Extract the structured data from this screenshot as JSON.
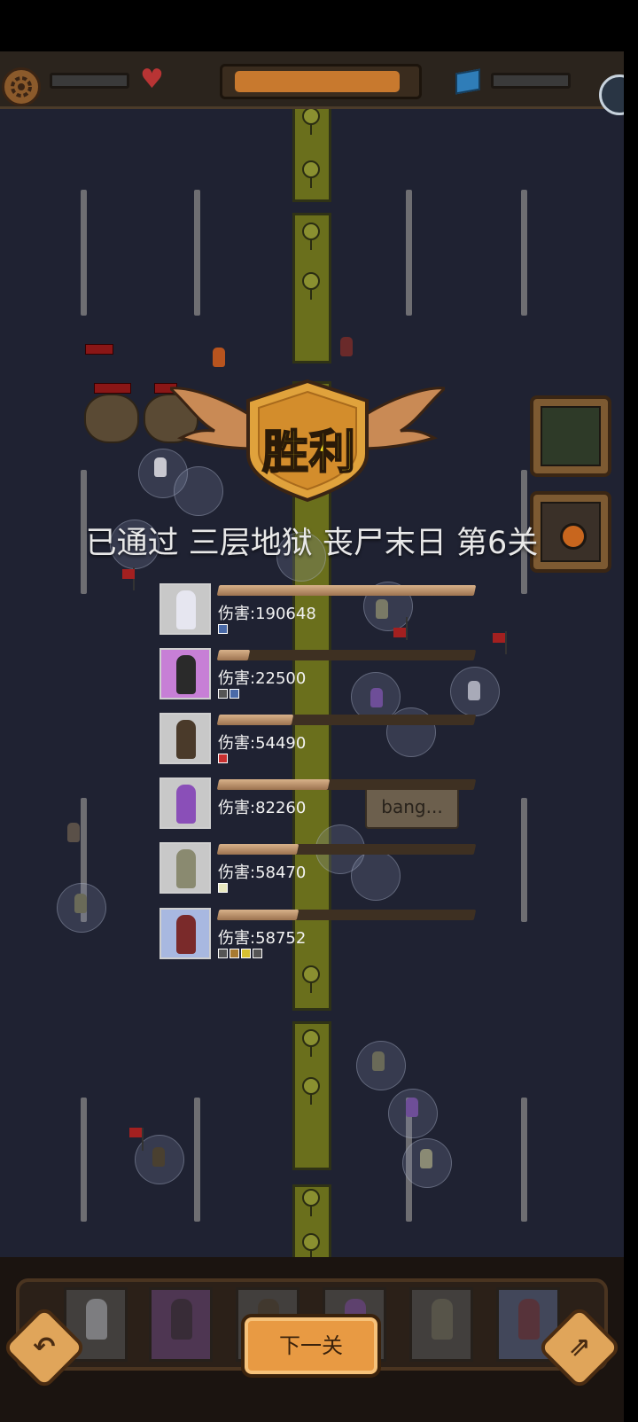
{
  "result": {
    "title": "胜利",
    "stage_text": "已通过 三层地狱 丧尸末日 第6关"
  },
  "heroes": [
    {
      "damage_text": "伤害:190648",
      "damage_value": 190648,
      "bar_fraction": 1.0,
      "portrait_bg": "#c8c8c8",
      "figure_color": "#e6e6f0",
      "buff_colors": [
        "#4a6aa8"
      ]
    },
    {
      "damage_text": "伤害:22500",
      "damage_value": 22500,
      "bar_fraction": 0.12,
      "portrait_bg": "#c77fd6",
      "figure_color": "#2a2a2a",
      "buff_colors": [
        "#555555",
        "#4a6aa8"
      ]
    },
    {
      "damage_text": "伤害:54490",
      "damage_value": 54490,
      "bar_fraction": 0.29,
      "portrait_bg": "#c8c8c8",
      "figure_color": "#4a3a2a",
      "buff_colors": [
        "#c83030"
      ]
    },
    {
      "damage_text": "伤害:82260",
      "damage_value": 82260,
      "bar_fraction": 0.43,
      "portrait_bg": "#c8c8c8",
      "figure_color": "#8a4fb8",
      "buff_colors": []
    },
    {
      "damage_text": "伤害:58470",
      "damage_value": 58470,
      "bar_fraction": 0.31,
      "portrait_bg": "#c8c8c8",
      "figure_color": "#8a8a70",
      "buff_colors": [
        "#e8e8c0"
      ]
    },
    {
      "damage_text": "伤害:58752",
      "damage_value": 58752,
      "bar_fraction": 0.31,
      "portrait_bg": "#a8b8e0",
      "figure_color": "#7a2a2a",
      "buff_colors": [
        "#555555",
        "#a87a30",
        "#d8c030",
        "#555555"
      ]
    }
  ],
  "battle": {
    "bang_text": "bang...",
    "progress_fraction": 0.95
  },
  "bottom": {
    "next_label": "下一关",
    "back_icon": "back-arrow-icon",
    "share_icon": "share-icon",
    "slots": [
      {
        "figure_color": "#cfd6e0",
        "bg": "#4a4a4a"
      },
      {
        "figure_color": "#2a2a2a",
        "bg": "#5a3e66"
      },
      {
        "figure_color": "#4a3a2a",
        "bg": "#4a4a4a"
      },
      {
        "figure_color": "#8a4fb8",
        "bg": "#4a4a4a"
      },
      {
        "figure_color": "#7a7a66",
        "bg": "#4a4a4a"
      },
      {
        "figure_color": "#7a2a2a",
        "bg": "#4a5470"
      }
    ]
  },
  "colors": {
    "victory_yellow": "#ffe922",
    "badge_orange": "#e0a23c",
    "wing_tan": "#c98a55",
    "background": "#1f2232",
    "median_green": "#6a6f1c"
  }
}
